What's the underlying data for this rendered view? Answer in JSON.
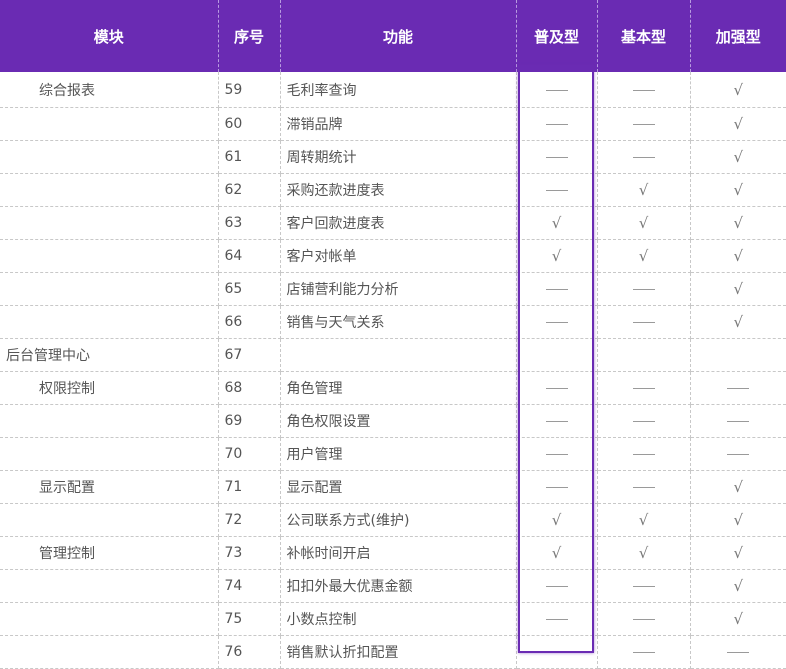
{
  "headers": [
    "模块",
    "序号",
    "功能",
    "普及型",
    "基本型",
    "加强型"
  ],
  "rows": [
    {
      "module": "综合报表",
      "level": 1,
      "num": "59",
      "func": "毛利率查询",
      "basic": "dash",
      "standard": "dash",
      "advanced": "check"
    },
    {
      "module": "",
      "level": 1,
      "num": "60",
      "func": "滞销品牌",
      "basic": "dash",
      "standard": "dash",
      "advanced": "check"
    },
    {
      "module": "",
      "level": 1,
      "num": "61",
      "func": "周转期统计",
      "basic": "dash",
      "standard": "dash",
      "advanced": "check"
    },
    {
      "module": "",
      "level": 1,
      "num": "62",
      "func": "采购还款进度表",
      "basic": "dash",
      "standard": "check",
      "advanced": "check"
    },
    {
      "module": "",
      "level": 1,
      "num": "63",
      "func": "客户回款进度表",
      "basic": "check",
      "standard": "check",
      "advanced": "check"
    },
    {
      "module": "",
      "level": 1,
      "num": "64",
      "func": "客户对帐单",
      "basic": "check",
      "standard": "check",
      "advanced": "check"
    },
    {
      "module": "",
      "level": 1,
      "num": "65",
      "func": "店铺营利能力分析",
      "basic": "dash",
      "standard": "dash",
      "advanced": "check"
    },
    {
      "module": "",
      "level": 1,
      "num": "66",
      "func": "销售与天气关系",
      "basic": "dash",
      "standard": "dash",
      "advanced": "check"
    },
    {
      "module": "后台管理中心",
      "level": 0,
      "num": "67",
      "func": "",
      "basic": "",
      "standard": "",
      "advanced": ""
    },
    {
      "module": "权限控制",
      "level": 1,
      "num": "68",
      "func": "角色管理",
      "basic": "dash",
      "standard": "dash",
      "advanced": "dash"
    },
    {
      "module": "",
      "level": 1,
      "num": "69",
      "func": "角色权限设置",
      "basic": "dash",
      "standard": "dash",
      "advanced": "dash"
    },
    {
      "module": "",
      "level": 1,
      "num": "70",
      "func": "用户管理",
      "basic": "dash",
      "standard": "dash",
      "advanced": "dash"
    },
    {
      "module": "显示配置",
      "level": 1,
      "num": "71",
      "func": "显示配置",
      "basic": "dash",
      "standard": "dash",
      "advanced": "check"
    },
    {
      "module": "",
      "level": 1,
      "num": "72",
      "func": "公司联系方式(维护)",
      "basic": "check",
      "standard": "check",
      "advanced": "check"
    },
    {
      "module": "管理控制",
      "level": 1,
      "num": "73",
      "func": "补帐时间开启",
      "basic": "check",
      "standard": "check",
      "advanced": "check"
    },
    {
      "module": "",
      "level": 1,
      "num": "74",
      "func": "扣扣外最大优惠金额",
      "basic": "dash",
      "standard": "dash",
      "advanced": "check"
    },
    {
      "module": "",
      "level": 1,
      "num": "75",
      "func": "小数点控制",
      "basic": "dash",
      "standard": "dash",
      "advanced": "check"
    },
    {
      "module": "",
      "level": 1,
      "num": "76",
      "func": "销售默认折扣配置",
      "basic": "dash",
      "standard": "dash",
      "advanced": "dash"
    }
  ],
  "colors": {
    "header_bg": "#6a2bb3",
    "highlight_border": "#6a2bb3"
  }
}
